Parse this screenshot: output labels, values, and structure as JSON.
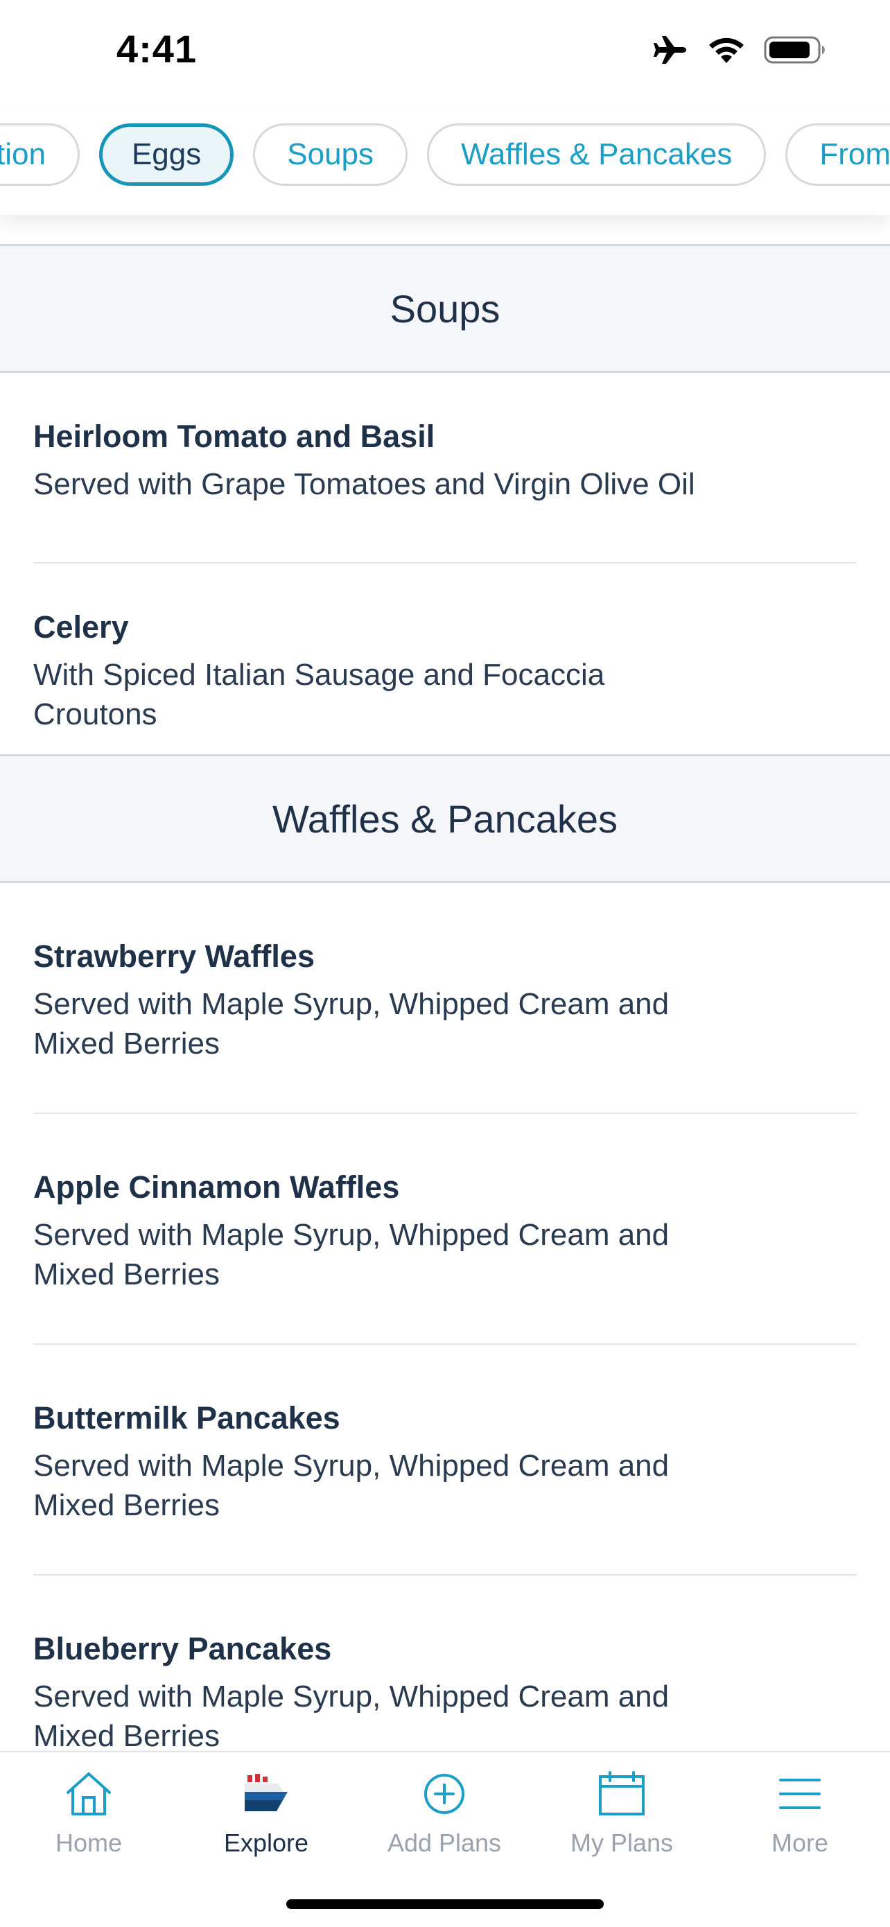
{
  "status_bar": {
    "time": "4:41"
  },
  "chips": [
    {
      "label": "tion",
      "active": false
    },
    {
      "label": "Eggs",
      "active": true
    },
    {
      "label": "Soups",
      "active": false
    },
    {
      "label": "Waffles & Pancakes",
      "active": false
    },
    {
      "label": "From",
      "active": false
    }
  ],
  "sections": [
    {
      "title": "Soups",
      "items": [
        {
          "name": "Heirloom Tomato and Basil",
          "description": "Served with Grape Tomatoes and Virgin Olive Oil"
        },
        {
          "name": "Celery",
          "description": "With Spiced Italian Sausage and Focaccia Croutons"
        }
      ]
    },
    {
      "title": "Waffles & Pancakes",
      "items": [
        {
          "name": "Strawberry Waffles",
          "description": "Served with Maple Syrup, Whipped Cream and Mixed Berries"
        },
        {
          "name": "Apple Cinnamon Waffles",
          "description": "Served with Maple Syrup, Whipped Cream and Mixed Berries"
        },
        {
          "name": "Buttermilk Pancakes",
          "description": "Served with Maple Syrup, Whipped Cream and Mixed Berries"
        },
        {
          "name": "Blueberry Pancakes",
          "description": "Served with Maple Syrup, Whipped Cream and Mixed Berries"
        }
      ]
    }
  ],
  "tab_bar": {
    "active": "Explore",
    "tabs": [
      {
        "label": "Home",
        "icon": "house-icon"
      },
      {
        "label": "Explore",
        "icon": "ship-icon"
      },
      {
        "label": "Add Plans",
        "icon": "plus-circle-icon"
      },
      {
        "label": "My Plans",
        "icon": "calendar-icon"
      },
      {
        "label": "More",
        "icon": "menu-icon"
      }
    ]
  },
  "colors": {
    "accent": "#1d9ec7",
    "navy": "#1f3148",
    "section_bg": "#f4f6f9",
    "inactive_tab": "#9aa3ad"
  }
}
